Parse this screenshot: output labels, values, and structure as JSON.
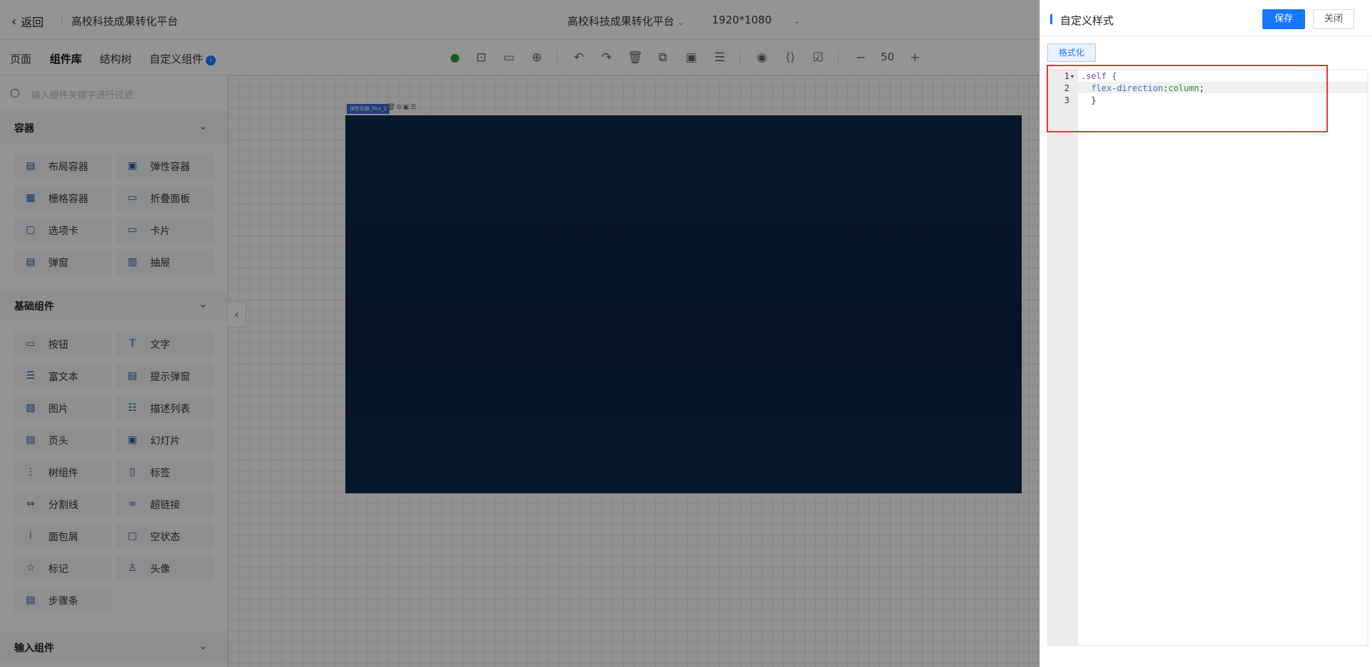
{
  "topbar": {
    "back_label": "返回",
    "app_title": "高校科技成果转化平台",
    "center_title": "高校科技成果转化平台",
    "resolution": "1920*1080"
  },
  "left_tabs": [
    {
      "label": "页面"
    },
    {
      "label": "组件库"
    },
    {
      "label": "结构树"
    },
    {
      "label": "自定义组件"
    }
  ],
  "toolbar": {
    "zoom": "50",
    "zoom_minus": "−",
    "zoom_plus": "+"
  },
  "search": {
    "placeholder": "输入组件关键字进行过滤"
  },
  "sections": [
    {
      "title": "容器",
      "items": [
        {
          "label": "布局容器",
          "icon": "layout-icon"
        },
        {
          "label": "弹性容器",
          "icon": "flex-icon"
        },
        {
          "label": "栅格容器",
          "icon": "grid-icon"
        },
        {
          "label": "折叠面板",
          "icon": "collapse-icon"
        },
        {
          "label": "选项卡",
          "icon": "tabs-icon"
        },
        {
          "label": "卡片",
          "icon": "card-icon"
        },
        {
          "label": "弹窗",
          "icon": "dialog-icon"
        },
        {
          "label": "抽屉",
          "icon": "drawer-icon"
        }
      ]
    },
    {
      "title": "基础组件",
      "items": [
        {
          "label": "按钮",
          "icon": "button-icon"
        },
        {
          "label": "文字",
          "icon": "text-icon"
        },
        {
          "label": "富文本",
          "icon": "richtext-icon"
        },
        {
          "label": "提示弹窗",
          "icon": "message-icon"
        },
        {
          "label": "图片",
          "icon": "image-icon"
        },
        {
          "label": "描述列表",
          "icon": "descriptions-icon"
        },
        {
          "label": "页头",
          "icon": "pageheader-icon"
        },
        {
          "label": "幻灯片",
          "icon": "carousel-icon"
        },
        {
          "label": "树组件",
          "icon": "tree-icon"
        },
        {
          "label": "标签",
          "icon": "tag-icon"
        },
        {
          "label": "分割线",
          "icon": "divider-icon"
        },
        {
          "label": "超链接",
          "icon": "link-icon"
        },
        {
          "label": "面包屑",
          "icon": "breadcrumb-icon"
        },
        {
          "label": "空状态",
          "icon": "empty-icon"
        },
        {
          "label": "标记",
          "icon": "pin-icon"
        },
        {
          "label": "头像",
          "icon": "avatar-icon"
        },
        {
          "label": "步骤条",
          "icon": "steps-icon"
        }
      ]
    },
    {
      "title": "输入组件",
      "items": []
    }
  ],
  "canvas": {
    "component_tag": "弹性容器_flex_1",
    "stage_color": "#0b2b4a"
  },
  "panel": {
    "title": "自定义样式",
    "save_label": "保存",
    "close_label": "关闭",
    "format_label": "格式化",
    "code_lines": [
      {
        "num": "1",
        "text": ".self {"
      },
      {
        "num": "2",
        "text": "  flex-direction:column;"
      },
      {
        "num": "3",
        "text": "  }"
      }
    ],
    "accent_color": "#1677ff",
    "highlight_color": "#e53935"
  }
}
